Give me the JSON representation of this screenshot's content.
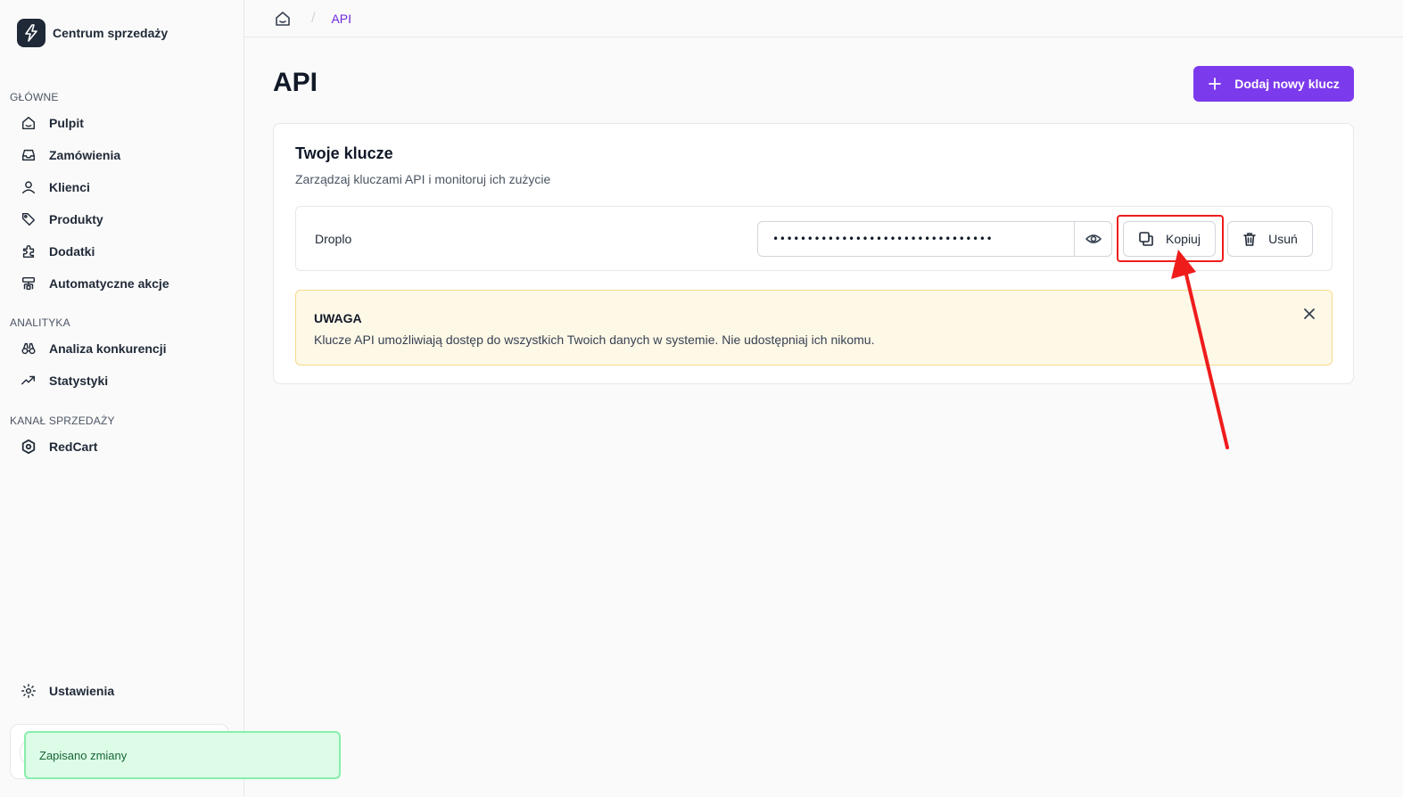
{
  "sidebar": {
    "brand": "Centrum sprzedaży",
    "sections": [
      {
        "label": "GŁÓWNE",
        "items": [
          {
            "label": "Pulpit",
            "icon": "home-icon"
          },
          {
            "label": "Zamówienia",
            "icon": "inbox-icon"
          },
          {
            "label": "Klienci",
            "icon": "user-icon"
          },
          {
            "label": "Produkty",
            "icon": "tag-icon"
          },
          {
            "label": "Dodatki",
            "icon": "puzzle-icon"
          },
          {
            "label": "Automatyczne akcje",
            "icon": "automation-icon"
          }
        ]
      },
      {
        "label": "ANALITYKA",
        "items": [
          {
            "label": "Analiza konkurencji",
            "icon": "binoculars-icon"
          },
          {
            "label": "Statystyki",
            "icon": "trending-up-icon"
          }
        ]
      },
      {
        "label": "KANAŁ SPRZEDAŻY",
        "items": [
          {
            "label": "RedCart",
            "icon": "hexagon-icon"
          }
        ]
      }
    ],
    "settings": "Ustawienia"
  },
  "breadcrumb": {
    "current": "API"
  },
  "page": {
    "title": "API",
    "add_button": "Dodaj nowy klucz"
  },
  "card": {
    "title": "Twoje klucze",
    "subtitle": "Zarządzaj kluczami API i monitoruj ich zużycie",
    "key": {
      "name": "Droplo",
      "masked_value": "••••••••••••••••••••••••••••••••",
      "copy_label": "Kopiuj",
      "delete_label": "Usuń"
    },
    "alert": {
      "title": "UWAGA",
      "text": "Klucze API umożliwiają dostęp do wszystkich Twoich danych w systemie. Nie udostępniaj ich nikomu."
    }
  },
  "toast": {
    "text": "Zapisano zmiany"
  },
  "colors": {
    "accent": "#7c3aed",
    "highlight": "#ef1c1c",
    "toast_bg": "#dcfce7",
    "alert_bg": "#fef8e7"
  }
}
